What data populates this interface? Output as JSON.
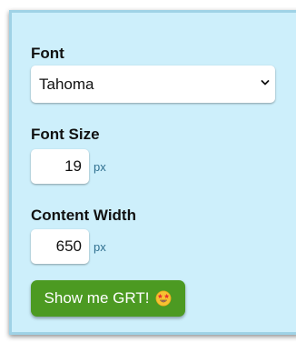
{
  "settings": {
    "font": {
      "label": "Font",
      "selected": "Tahoma"
    },
    "font_size": {
      "label": "Font Size",
      "value": "19",
      "unit": "px"
    },
    "content_width": {
      "label": "Content Width",
      "value": "650",
      "unit": "px"
    },
    "submit": {
      "label": "Show me GRT!",
      "icon": "star-struck-emoji-icon"
    }
  },
  "colors": {
    "panel_background": "#cdeffb",
    "panel_border": "#9fd2e6",
    "button_background": "#4c9a22",
    "unit_text": "#2f6f8f"
  }
}
